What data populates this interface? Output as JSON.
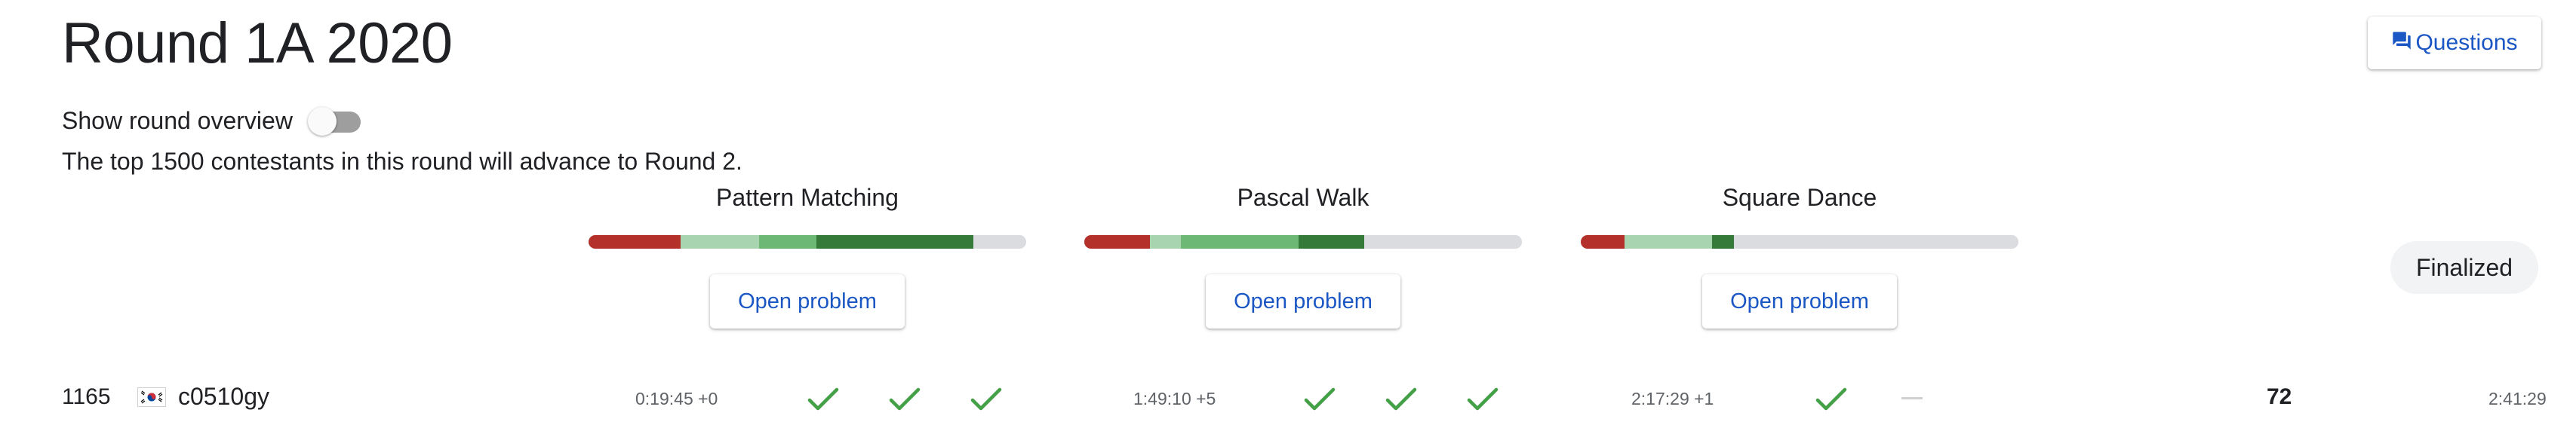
{
  "round": {
    "title": "Round 1A 2020",
    "questions_label": "Questions",
    "overview_label": "Show round overview",
    "overview_enabled": false,
    "advance_text": "The top 1500 contestants in this round will advance to Round 2.",
    "status": "Finalized"
  },
  "problems": [
    {
      "name": "Pattern Matching",
      "button": "Open problem",
      "distribution": [
        {
          "fraction": 0.21,
          "color": "#b3312a"
        },
        {
          "fraction": 0.18,
          "color": "#a8d5b0"
        },
        {
          "fraction": 0.13,
          "color": "#6db874"
        },
        {
          "fraction": 0.36,
          "color": "#357a38"
        },
        {
          "fraction": 0.12,
          "color": "#dadce0"
        }
      ]
    },
    {
      "name": "Pascal Walk",
      "button": "Open problem",
      "distribution": [
        {
          "fraction": 0.15,
          "color": "#b3312a"
        },
        {
          "fraction": 0.07,
          "color": "#a8d5b0"
        },
        {
          "fraction": 0.27,
          "color": "#6db874"
        },
        {
          "fraction": 0.15,
          "color": "#357a38"
        },
        {
          "fraction": 0.36,
          "color": "#dadce0"
        }
      ]
    },
    {
      "name": "Square Dance",
      "button": "Open problem",
      "distribution": [
        {
          "fraction": 0.1,
          "color": "#b3312a"
        },
        {
          "fraction": 0.2,
          "color": "#a8d5b0"
        },
        {
          "fraction": 0.05,
          "color": "#357a38"
        },
        {
          "fraction": 0.65,
          "color": "#dadce0"
        }
      ]
    }
  ],
  "scoreboard": [
    {
      "rank": "1165",
      "country_flag": "south-korea-flag",
      "username": "c0510gy",
      "problems": [
        {
          "time": "0:19:45 +0",
          "tests": [
            "solved",
            "solved",
            "solved"
          ]
        },
        {
          "time": "1:49:10 +5",
          "tests": [
            "solved",
            "solved",
            "solved"
          ]
        },
        {
          "time": "2:17:29 +1",
          "tests": [
            "solved",
            "unattempted"
          ]
        }
      ],
      "score": "72",
      "penalty_time": "2:41:29"
    }
  ],
  "colors": {
    "accent": "#1a56c4",
    "solved_check": "#43a047"
  }
}
